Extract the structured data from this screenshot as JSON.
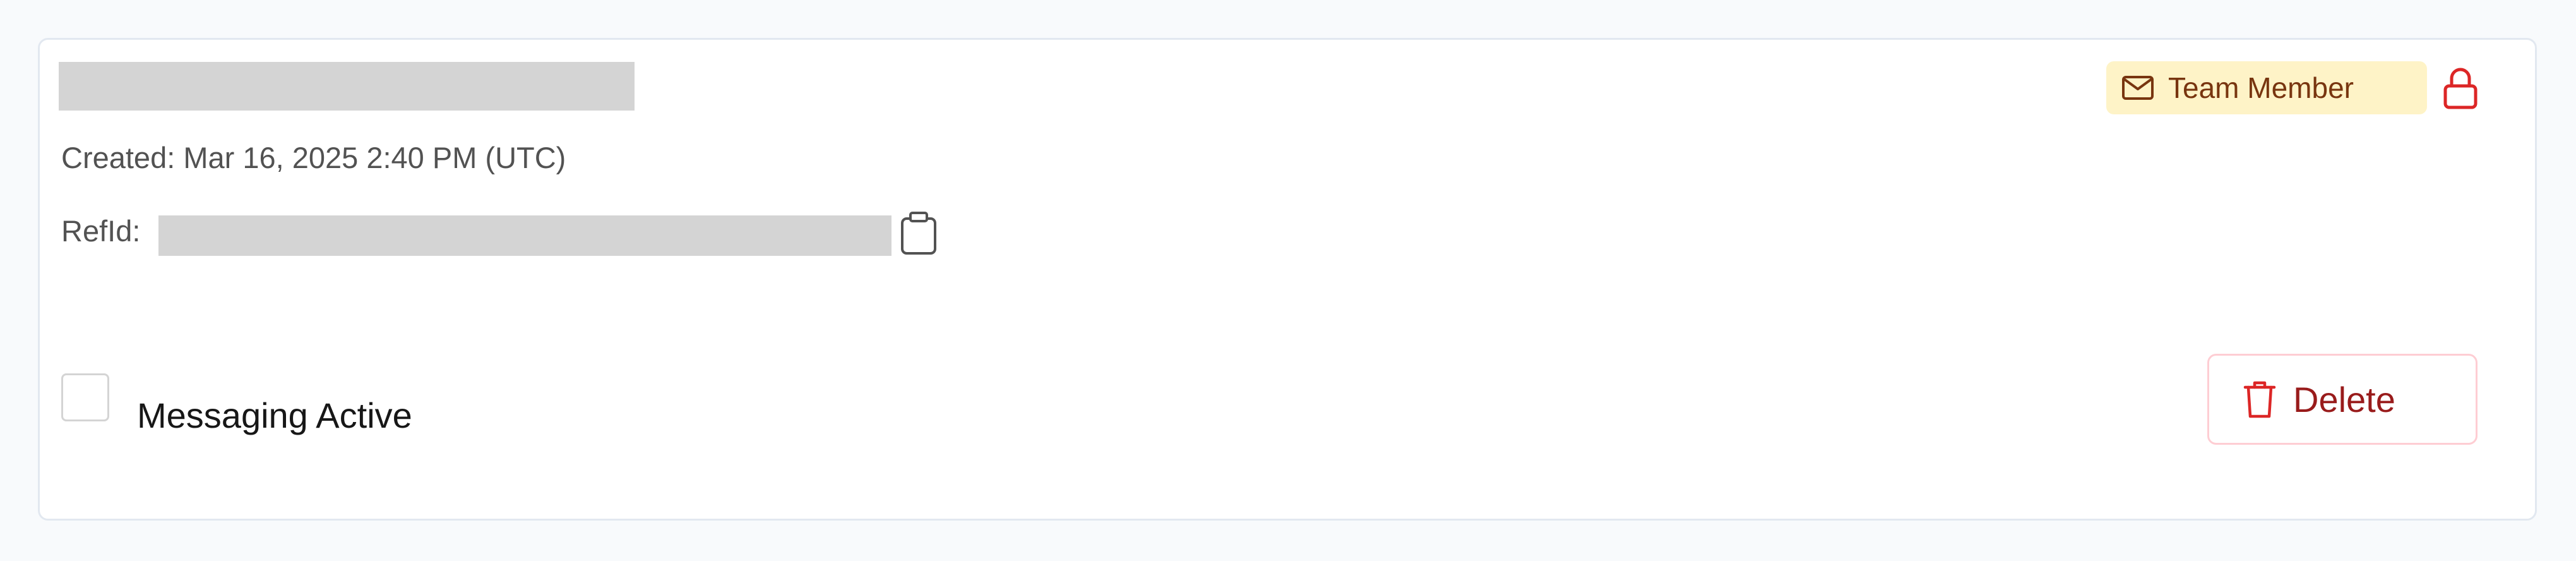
{
  "record": {
    "created_text": "Created: Mar 16, 2025 2:40 PM (UTC)",
    "refid_label": "RefId:"
  },
  "badge": {
    "label": "Team Member",
    "icon": "mail-icon"
  },
  "lock": {
    "icon": "lock-icon"
  },
  "messaging": {
    "label": "Messaging Active",
    "checked": false
  },
  "actions": {
    "delete_label": "Delete",
    "delete_icon": "trash-icon"
  },
  "colors": {
    "badge_bg": "#fef3c7",
    "badge_text": "#78350f",
    "danger": "#dc2626",
    "danger_text": "#991b1b",
    "redaction": "#d4d4d4"
  }
}
